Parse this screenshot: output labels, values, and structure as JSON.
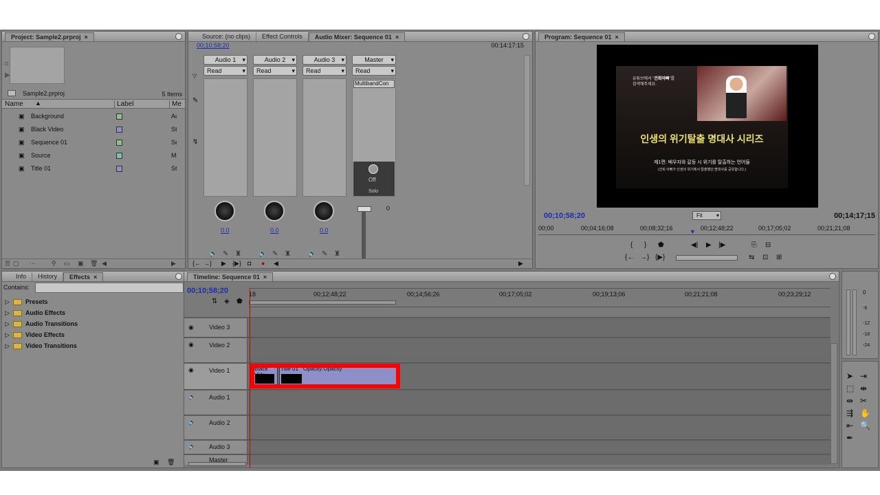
{
  "project": {
    "tab_title": "Project: Sample2.prproj",
    "file_name": "Sample2.prproj",
    "item_count": "5 Items",
    "col_name": "Name",
    "col_label": "Label",
    "col_media": "Me",
    "items": [
      {
        "name": "Background",
        "type": "Au",
        "color": "#8fbf8f"
      },
      {
        "name": "Black Video",
        "type": "Stil",
        "color": "#8f8fc8"
      },
      {
        "name": "Sequence 01",
        "type": "Sec",
        "color": "#8fbf8f"
      },
      {
        "name": "Source",
        "type": "Mo",
        "color": "#7fbfaf"
      },
      {
        "name": "Title 01",
        "type": "Stil",
        "color": "#8f8fc8"
      }
    ]
  },
  "effects": {
    "tabs": [
      "Info",
      "History",
      "Effects"
    ],
    "contains_label": "Contains:",
    "folders": [
      "Presets",
      "Audio Effects",
      "Audio Transitions",
      "Video Effects",
      "Video Transitions"
    ]
  },
  "mixer": {
    "tabs": [
      "Source: (no clips)",
      "Effect Controls",
      "Audio Mixer: Sequence 01"
    ],
    "timecode_left": "00;10;58;20",
    "timecode_right": "00:14:17:15",
    "channels": [
      {
        "name": "Audio 1",
        "mode": "Read",
        "value": "0.0"
      },
      {
        "name": "Audio 2",
        "mode": "Read",
        "value": "0.0"
      },
      {
        "name": "Audio 3",
        "mode": "Read",
        "value": "0.0"
      }
    ],
    "master": {
      "name": "Master",
      "mode": "Read",
      "effect": "MultibandCon",
      "knob_label": "Off",
      "solo": "Solo",
      "db_zero": "0"
    }
  },
  "program": {
    "tab_title": "Program: Sequence 01",
    "video": {
      "top_line1_a": "유튜브에서 \"",
      "top_line1_hl": "건희아빠",
      "top_line1_b": "\"를",
      "top_line2": "검색해주세요.",
      "title": "인생의 위기탈출 명대사 시리즈",
      "episode": "제1편: 배우자와 갈등 시 위기를 탈출하는 언어들",
      "caption": "(건희 아빠가 인생의 위기에서 탈출했던 명대사를 공유합니다.)"
    },
    "timecode_left": "00;10;58;20",
    "fit": "Fit",
    "timecode_right": "00;14;17;15",
    "ruler": [
      "00;00",
      "00;04;16;08",
      "00;08;32;16",
      "00;12;48;22",
      "00;17;05;02",
      "00;21;21;08"
    ]
  },
  "timeline": {
    "tab_title": "Timeline: Sequence 01",
    "timecode": "00;10;58;20",
    "ruler": [
      "00;12;48;22",
      "00;14;56;26",
      "00;17;05;02",
      "00;19;13;06",
      "00;21;21;08",
      "00;23;29;12"
    ],
    "ruler_start": "18",
    "tracks": [
      "Video 3",
      "Video 2",
      "Video 1",
      "Audio 1",
      "Audio 2",
      "Audio 3",
      "Master"
    ],
    "clip1_label": "Black Vide",
    "clip2_label": "Title 01",
    "clip_opacity": "Opacity:Opacity",
    "highlight_color": "#ff0000"
  },
  "meters": {
    "labels": [
      "0",
      "-6",
      "-12",
      "-18",
      "-24"
    ]
  }
}
